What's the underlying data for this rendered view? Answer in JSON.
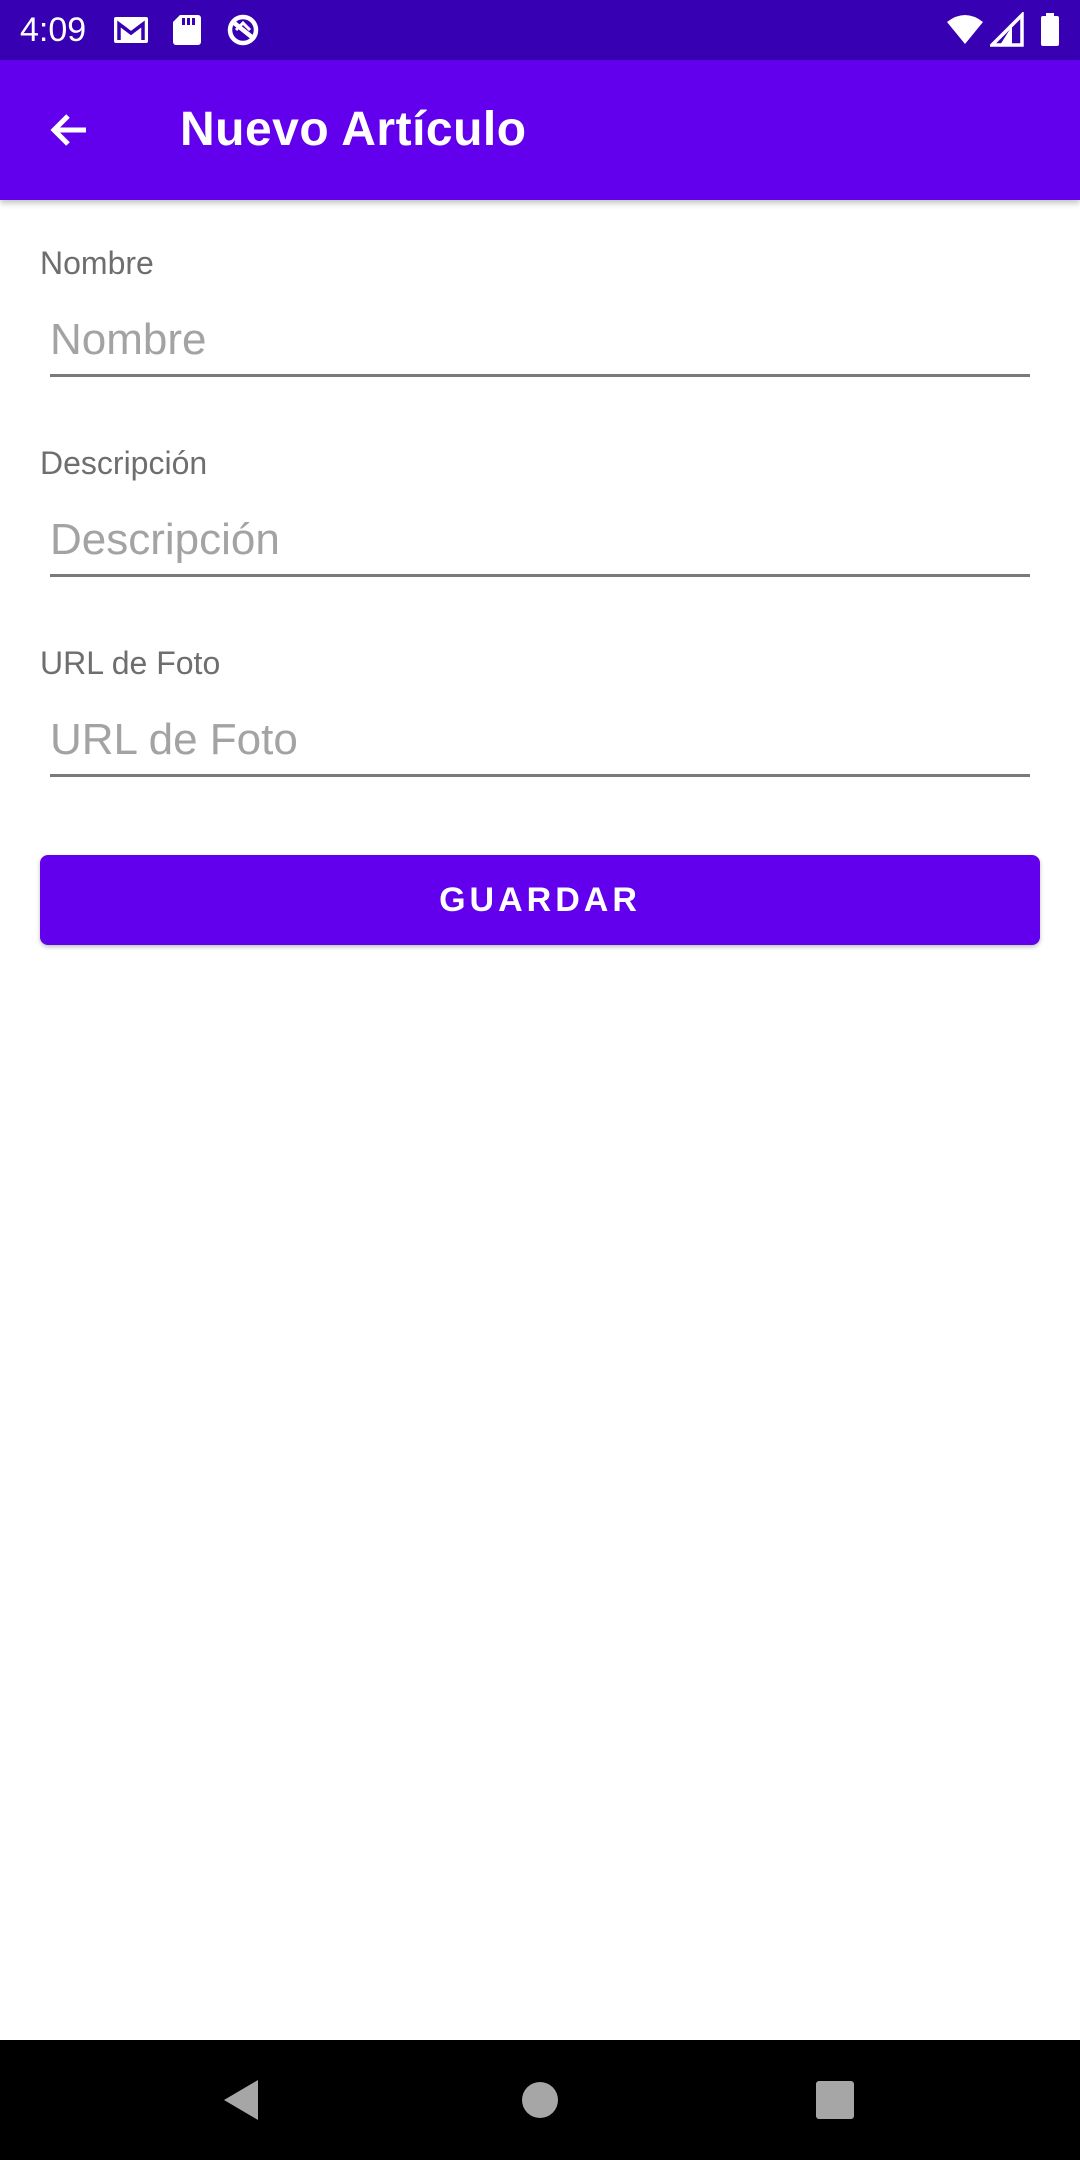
{
  "status_bar": {
    "time": "4:09",
    "left_icons": [
      "gmail-icon",
      "sd-card-icon",
      "data-saver-icon"
    ],
    "right_icons": [
      "wifi-icon",
      "cell-signal-icon",
      "battery-icon"
    ],
    "background": "#3700b3"
  },
  "app_bar": {
    "title": "Nuevo Artículo",
    "back_icon": "arrow-back-icon",
    "background": "#6200ee"
  },
  "form": {
    "fields": [
      {
        "label": "Nombre",
        "placeholder": "Nombre",
        "value": ""
      },
      {
        "label": "Descripción",
        "placeholder": "Descripción",
        "value": ""
      },
      {
        "label": "URL de Foto",
        "placeholder": "URL de Foto",
        "value": ""
      }
    ],
    "save_label": "GUARDAR",
    "accent": "#6200ee"
  },
  "nav_bar": {
    "buttons": [
      "back-triangle-icon",
      "home-circle-icon",
      "recents-square-icon"
    ]
  }
}
